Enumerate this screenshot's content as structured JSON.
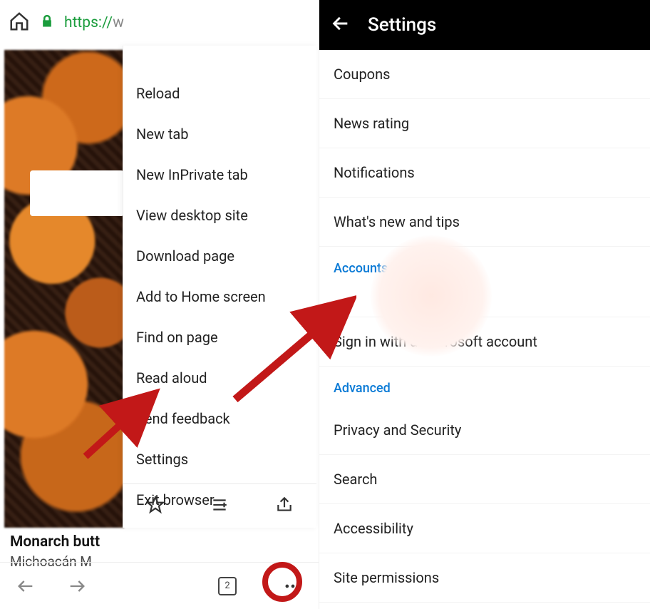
{
  "left": {
    "url_prefix": "https://",
    "url_rest": "w",
    "menu": [
      "Reload",
      "New tab",
      "New InPrivate tab",
      "View desktop site",
      "Download page",
      "Add to Home screen",
      "Find on page",
      "Read aloud",
      "Send feedback",
      "Settings",
      "Exit browser"
    ],
    "caption_title": "Monarch butt",
    "caption_sub": "Michoacán  M",
    "tab_count": "2"
  },
  "right": {
    "title": "Settings",
    "items_top": [
      "Coupons",
      "News rating",
      "Notifications",
      "What's new and tips"
    ],
    "section_accounts": "Accounts",
    "signin": "Sign in with a Microsoft account",
    "section_advanced": "Advanced",
    "items_bottom": [
      "Privacy and Security",
      "Search",
      "Accessibility",
      "Site permissions"
    ]
  },
  "annotations": {
    "arrow1_target": "Settings menu item",
    "arrow2_target": "Sign in with a Microsoft account",
    "circle_target": "More (three dots) button"
  }
}
